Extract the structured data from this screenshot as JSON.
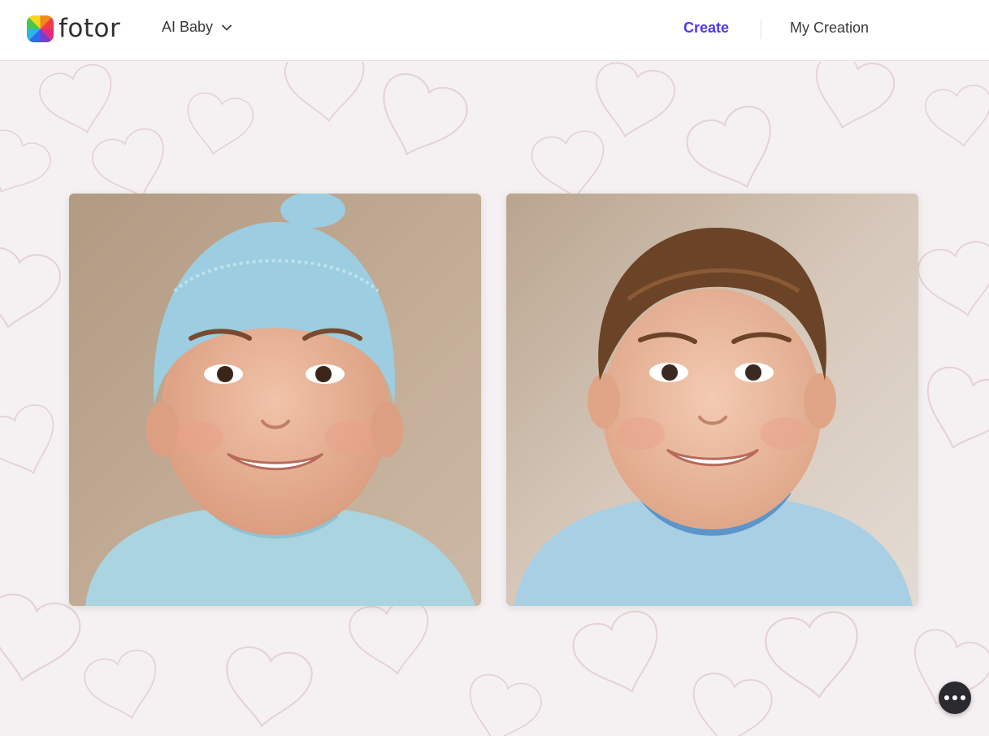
{
  "header": {
    "logo_text": "fotor",
    "product_menu_label": "AI Baby",
    "nav": {
      "create_label": "Create",
      "my_creation_label": "My Creation"
    }
  },
  "colors": {
    "accent": "#4b38f5",
    "text": "#3a3a3e",
    "background": "#f5f1f2"
  },
  "icons": {
    "product_menu": "chevron-down-icon",
    "floating_action": "more-horizontal-icon"
  }
}
